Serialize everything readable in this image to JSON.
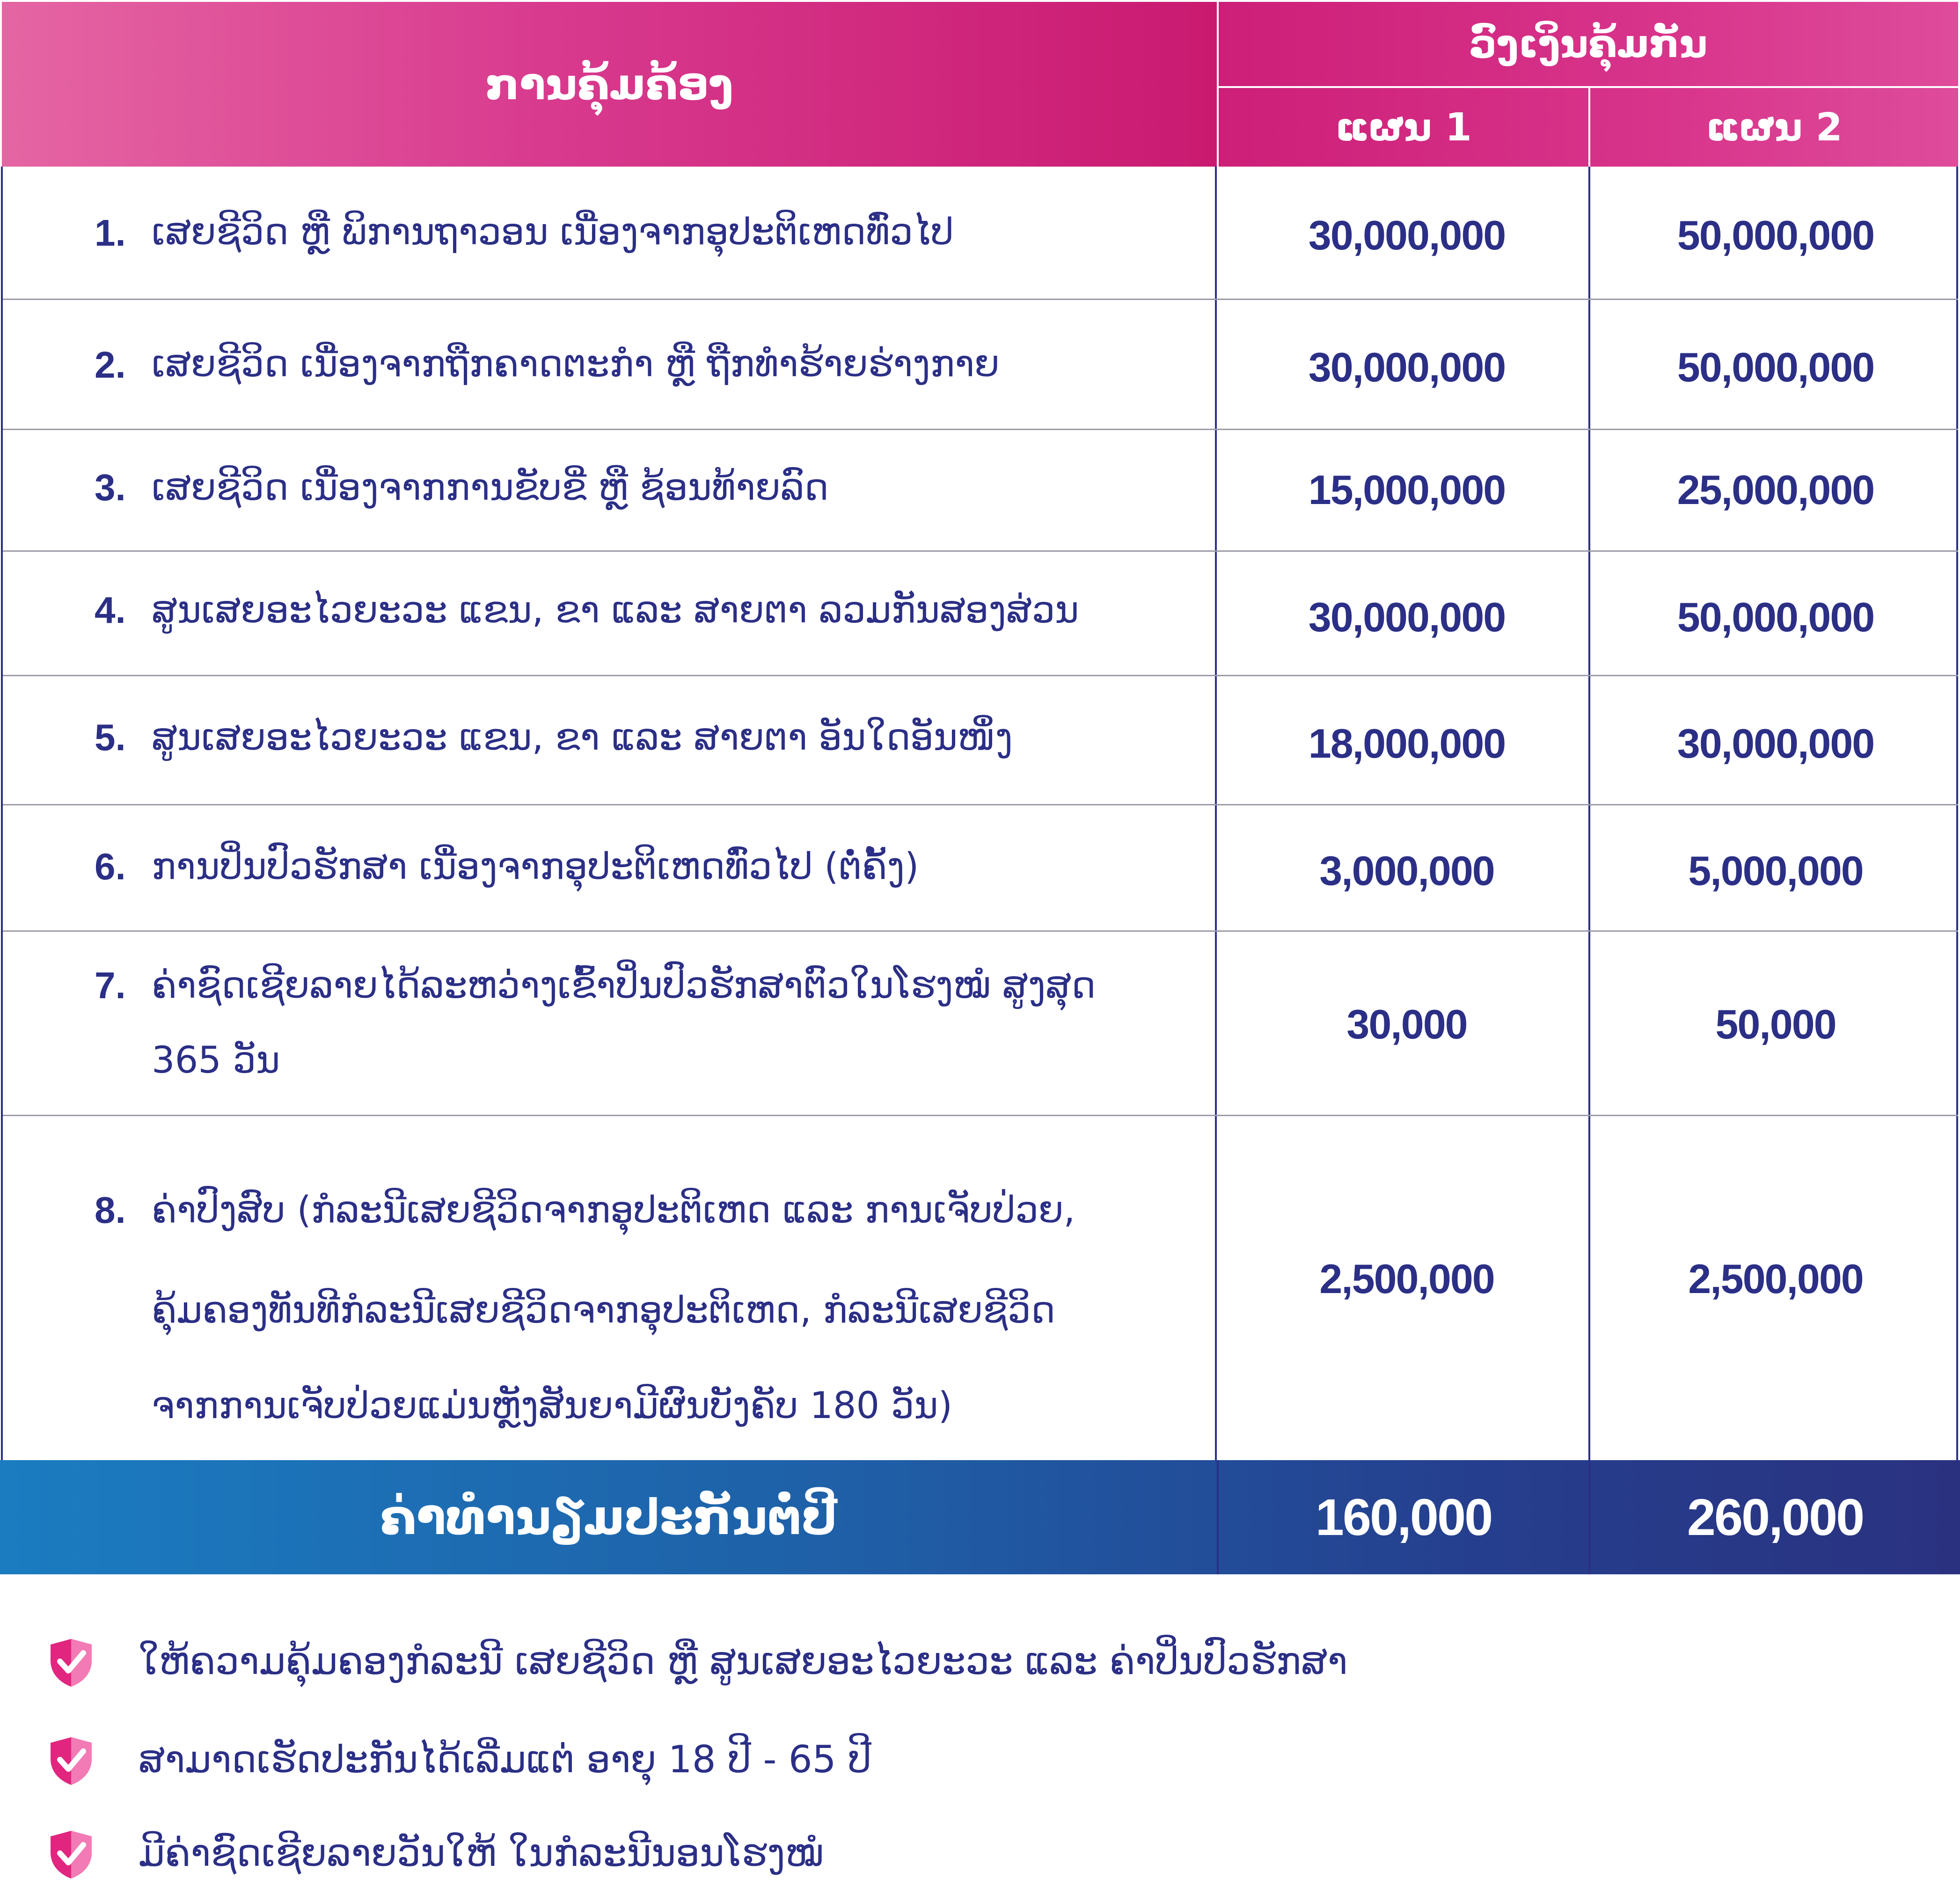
{
  "header": {
    "coverage_title": "ການຄຸ້ມຄ້ອງ",
    "sum_insured_title": "ວົງເງິນຄຸ້ມກັນ",
    "plan1": "ແຜນ 1",
    "plan2": "ແຜນ 2"
  },
  "rows": [
    {
      "num": "1.",
      "lines": [
        "ເສຍຊີວິດ ຫຼື ພິການຖາວອນ ເນື່ອງຈາກອຸປະຕິເຫດທົ່ວໄປ"
      ],
      "plan1": "30,000,000",
      "plan2": "50,000,000"
    },
    {
      "num": "2.",
      "lines": [
        "ເສຍຊີວິດ ເນື່ອງຈາກຖືກຄາດຕະກໍາ ຫຼື ຖືກທໍາຮ້າຍຮ່າງກາຍ"
      ],
      "plan1": "30,000,000",
      "plan2": "50,000,000"
    },
    {
      "num": "3.",
      "lines": [
        "ເສຍຊີວິດ ເນື່ອງຈາກການຂັບຂີ່ ຫຼື ຊ້ອນທ້າຍລົດ"
      ],
      "plan1": "15,000,000",
      "plan2": "25,000,000"
    },
    {
      "num": "4.",
      "lines": [
        "ສູນເສຍອະໄວຍະວະ ແຂນ, ຂາ ແລະ ສາຍຕາ ລວມກັນສອງສ່ວນ"
      ],
      "plan1": "30,000,000",
      "plan2": "50,000,000"
    },
    {
      "num": "5.",
      "lines": [
        "ສູນເສຍອະໄວຍະວະ ແຂນ, ຂາ ແລະ ສາຍຕາ ອັນໃດອັນໜຶ່ງ"
      ],
      "plan1": "18,000,000",
      "plan2": "30,000,000"
    },
    {
      "num": "6.",
      "lines": [
        "ການປິ່ນປົວຮັກສາ ເນື່ອງຈາກອຸປະຕິເຫດທົ່ວໄປ (ຕໍ່ຄັ້ງ)"
      ],
      "plan1": "3,000,000",
      "plan2": "5,000,000"
    },
    {
      "num": "7.",
      "lines": [
        "ຄ່າຊົດເຊີຍລາຍໄດ້ລະຫວ່າງເຂົ້າປິ່ນປົວຮັກສາຕົວໃນໂຮງໝໍ ສູງສຸດ",
        "365 ວັນ"
      ],
      "plan1": "30,000",
      "plan2": "50,000"
    },
    {
      "num": "8.",
      "lines": [
        "ຄ່າປົງສົບ (ກໍລະນີເສຍຊີວິດຈາກອຸປະຕິເຫດ ແລະ ການເຈັບປ່ວຍ,",
        "ຄຸ້ມຄອງທັນທີກໍລະນີເສຍຊີວິດຈາກອຸປະຕິເຫດ, ກໍລະນີເສຍຊີວິດ",
        "ຈາກການເຈັບປ່ວຍແມ່ນຫຼັງສັນຍາມີຜົນບັງຄັບ 180 ວັນ)"
      ],
      "plan1": "2,500,000",
      "plan2": "2,500,000"
    }
  ],
  "total": {
    "label": "ຄ່າທໍານຽມປະກັນຕໍ່ປີ",
    "plan1": "160,000",
    "plan2": "260,000"
  },
  "bullets": [
    "ໃຫ້ຄວາມຄຸ້ມຄອງກໍລະນີ ເສຍຊີວິດ ຫຼື ສູນເສຍອະໄວຍະວະ ແລະ ຄ່າປິ່ນປົວຮັກສາ",
    "ສາມາດເຮັດປະກັນໄດ້ເລີ່ມແຕ່ ອາຍຸ 18 ປີ - 65 ປີ",
    "ມີຄ່າຊົດເຊີຍລາຍວັນໃຫ້ ໃນກໍລະນີນອນໂຮງໝໍ"
  ],
  "colors": {
    "header_pink": "#d52a82",
    "text_navy": "#2b2f86",
    "total_blue_start": "#1b7cc0",
    "total_blue_end": "#2a3280",
    "bullet_icon": "shield-check-icon"
  }
}
